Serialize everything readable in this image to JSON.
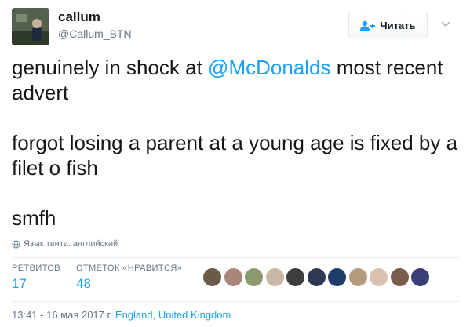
{
  "author": {
    "name": "callum",
    "handle": "@Callum_BTN"
  },
  "follow_button": {
    "label": "Читать",
    "icon": "follow-person-icon"
  },
  "menu": {
    "icon": "chevron-down-icon"
  },
  "tweet": {
    "line1_before": "genuinely in shock at ",
    "mention": "@McDonalds",
    "line1_after": " most recent advert",
    "paragraph2": "forgot losing a parent at a young age is fixed by a filet o fish",
    "paragraph3": "smfh"
  },
  "language": {
    "icon": "globe-icon",
    "text": "Язык твита: английский"
  },
  "stats": {
    "retweets_label": "РЕТВИТОВ",
    "retweets_count": "17",
    "likes_label": "ОТМЕТОК «НРАВИТСЯ»",
    "likes_count": "48"
  },
  "likers": [
    {
      "color": "#6b5a48"
    },
    {
      "color": "#a8877a"
    },
    {
      "color": "#8a9a6e"
    },
    {
      "color": "#c9b8a6"
    },
    {
      "color": "#3d3d3d"
    },
    {
      "color": "#2f3a52"
    },
    {
      "color": "#1e3d6b"
    },
    {
      "color": "#b49b7d"
    },
    {
      "color": "#d8c2b2"
    },
    {
      "color": "#7a5c4f"
    },
    {
      "color": "#3a3f7a"
    }
  ],
  "meta": {
    "datetime": "13:41 - 16 мая 2017 г.",
    "location": "England, United Kingdom"
  },
  "colors": {
    "link": "#1da1f2",
    "secondary_text": "#657786",
    "primary_text": "#14171a"
  }
}
